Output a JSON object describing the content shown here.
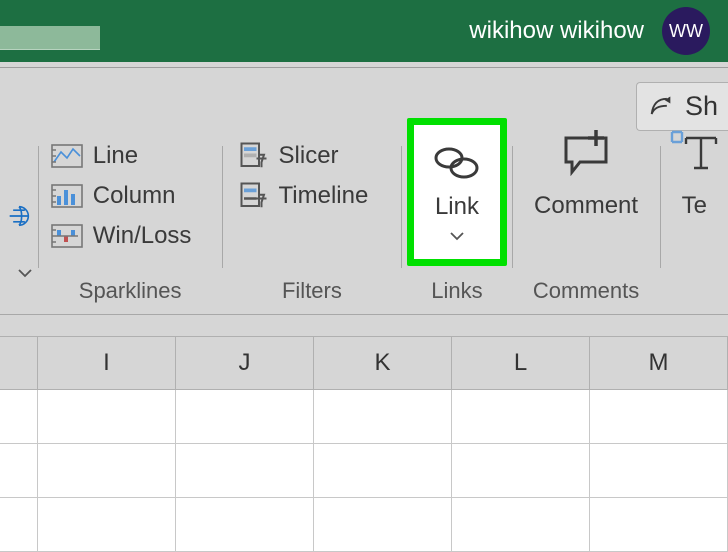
{
  "titlebar": {
    "user_name": "wikihow wikihow",
    "avatar_initials": "WW"
  },
  "share": {
    "label": "Sh"
  },
  "ribbon": {
    "sparklines": {
      "group_label": "Sparklines",
      "line": "Line",
      "column": "Column",
      "winloss": "Win/Loss"
    },
    "filters": {
      "group_label": "Filters",
      "slicer": "Slicer",
      "timeline": "Timeline"
    },
    "links": {
      "group_label": "Links",
      "link": "Link"
    },
    "comments": {
      "group_label": "Comments",
      "comment": "Comment"
    },
    "text": {
      "partial_label": "Te"
    }
  },
  "sheet": {
    "columns": [
      "I",
      "J",
      "K",
      "L",
      "M"
    ]
  }
}
